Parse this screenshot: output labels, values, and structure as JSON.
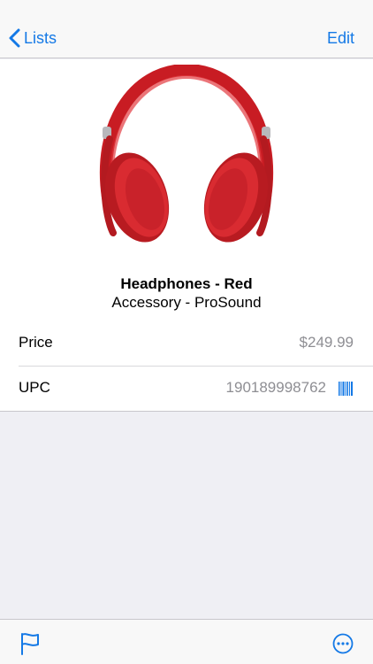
{
  "navbar": {
    "back_label": "Lists",
    "edit_label": "Edit"
  },
  "product": {
    "name": "Headphones - Red",
    "subtitle": "Accessory - ProSound",
    "image_icon": "headphones-image"
  },
  "details": {
    "price_label": "Price",
    "price_value": "$249.99",
    "upc_label": "UPC",
    "upc_value": "190189998762"
  },
  "toolbar": {
    "flag_icon": "flag-icon",
    "more_icon": "more-icon"
  },
  "colors": {
    "accent": "#1479e6",
    "product_red": "#d21f26",
    "secondary_text": "#8e8e93"
  }
}
